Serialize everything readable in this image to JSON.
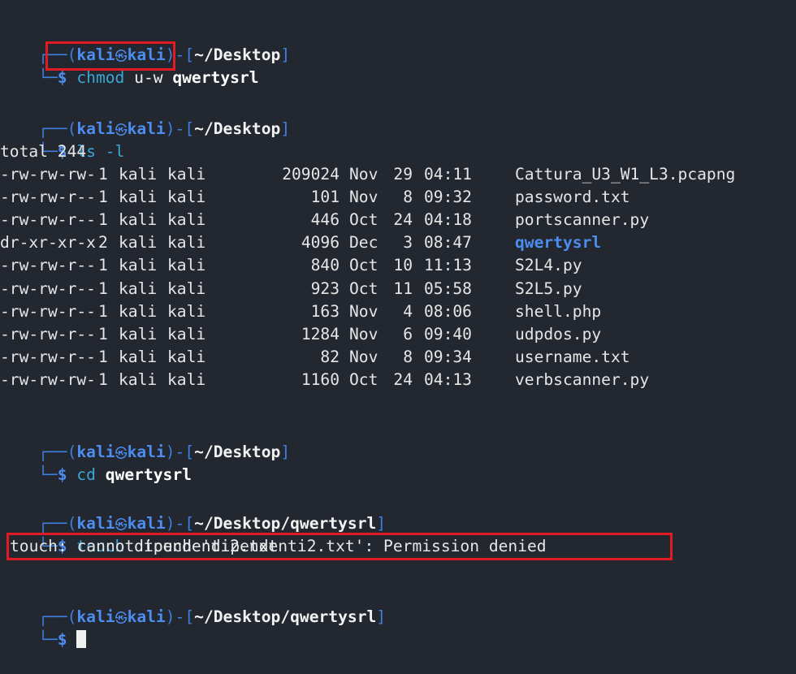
{
  "prompt": {
    "user": "kali",
    "host": "kali",
    "at_symbol": "㉿",
    "frame_top": "┌──(",
    "frame_mid": ")-[",
    "frame_end": "]",
    "frame_bottom": "└─",
    "dollar": "$"
  },
  "blocks": [
    {
      "path": "~/Desktop",
      "command": "chmod",
      "args": "u-w",
      "args_bold": "qwertysrl"
    },
    {
      "path": "~/Desktop",
      "command": "ls",
      "args": "-l",
      "args_bold": ""
    },
    {
      "path": "~/Desktop",
      "command": "cd",
      "args": "",
      "args_bold": "qwertysrl"
    },
    {
      "path": "~/Desktop/qwertysrl",
      "command": "touch",
      "args": "dipendenti2.txt",
      "args_bold": ""
    },
    {
      "path": "~/Desktop/qwertysrl",
      "command": "",
      "args": "",
      "args_bold": ""
    }
  ],
  "ls_output": {
    "total": "total 244",
    "rows": [
      {
        "perms": "-rw-rw-rw-",
        "links": "1",
        "owner": "kali",
        "group": "kali",
        "size": "209024",
        "month": "Nov",
        "day": "29",
        "time": "04:11",
        "name": "Cattura_U3_W1_L3.pcapng"
      },
      {
        "perms": "-rw-rw-r--",
        "links": "1",
        "owner": "kali",
        "group": "kali",
        "size": "101",
        "month": "Nov",
        "day": "8",
        "time": "09:32",
        "name": "password.txt"
      },
      {
        "perms": "-rw-rw-r--",
        "links": "1",
        "owner": "kali",
        "group": "kali",
        "size": "446",
        "month": "Oct",
        "day": "24",
        "time": "04:18",
        "name": "portscanner.py"
      },
      {
        "perms": "dr-xr-xr-x",
        "links": "2",
        "owner": "kali",
        "group": "kali",
        "size": "4096",
        "month": "Dec",
        "day": "3",
        "time": "08:47",
        "name": "qwertysrl",
        "is_dir": true
      },
      {
        "perms": "-rw-rw-r--",
        "links": "1",
        "owner": "kali",
        "group": "kali",
        "size": "840",
        "month": "Oct",
        "day": "10",
        "time": "11:13",
        "name": "S2L4.py"
      },
      {
        "perms": "-rw-rw-r--",
        "links": "1",
        "owner": "kali",
        "group": "kali",
        "size": "923",
        "month": "Oct",
        "day": "11",
        "time": "05:58",
        "name": "S2L5.py"
      },
      {
        "perms": "-rw-rw-r--",
        "links": "1",
        "owner": "kali",
        "group": "kali",
        "size": "163",
        "month": "Nov",
        "day": "4",
        "time": "08:06",
        "name": "shell.php"
      },
      {
        "perms": "-rw-rw-r--",
        "links": "1",
        "owner": "kali",
        "group": "kali",
        "size": "1284",
        "month": "Nov",
        "day": "6",
        "time": "09:40",
        "name": "udpdos.py"
      },
      {
        "perms": "-rw-rw-r--",
        "links": "1",
        "owner": "kali",
        "group": "kali",
        "size": "82",
        "month": "Nov",
        "day": "8",
        "time": "09:34",
        "name": "username.txt"
      },
      {
        "perms": "-rw-rw-rw-",
        "links": "1",
        "owner": "kali",
        "group": "kali",
        "size": "1160",
        "month": "Oct",
        "day": "24",
        "time": "04:13",
        "name": "verbscanner.py"
      }
    ]
  },
  "error_output": "touch: cannot touch 'dipendenti2.txt': Permission denied",
  "colors": {
    "background": "#23272f",
    "prompt_blue": "#4d8df0",
    "command_cyan": "#3aa7d8",
    "highlight_red": "#e01b24"
  }
}
